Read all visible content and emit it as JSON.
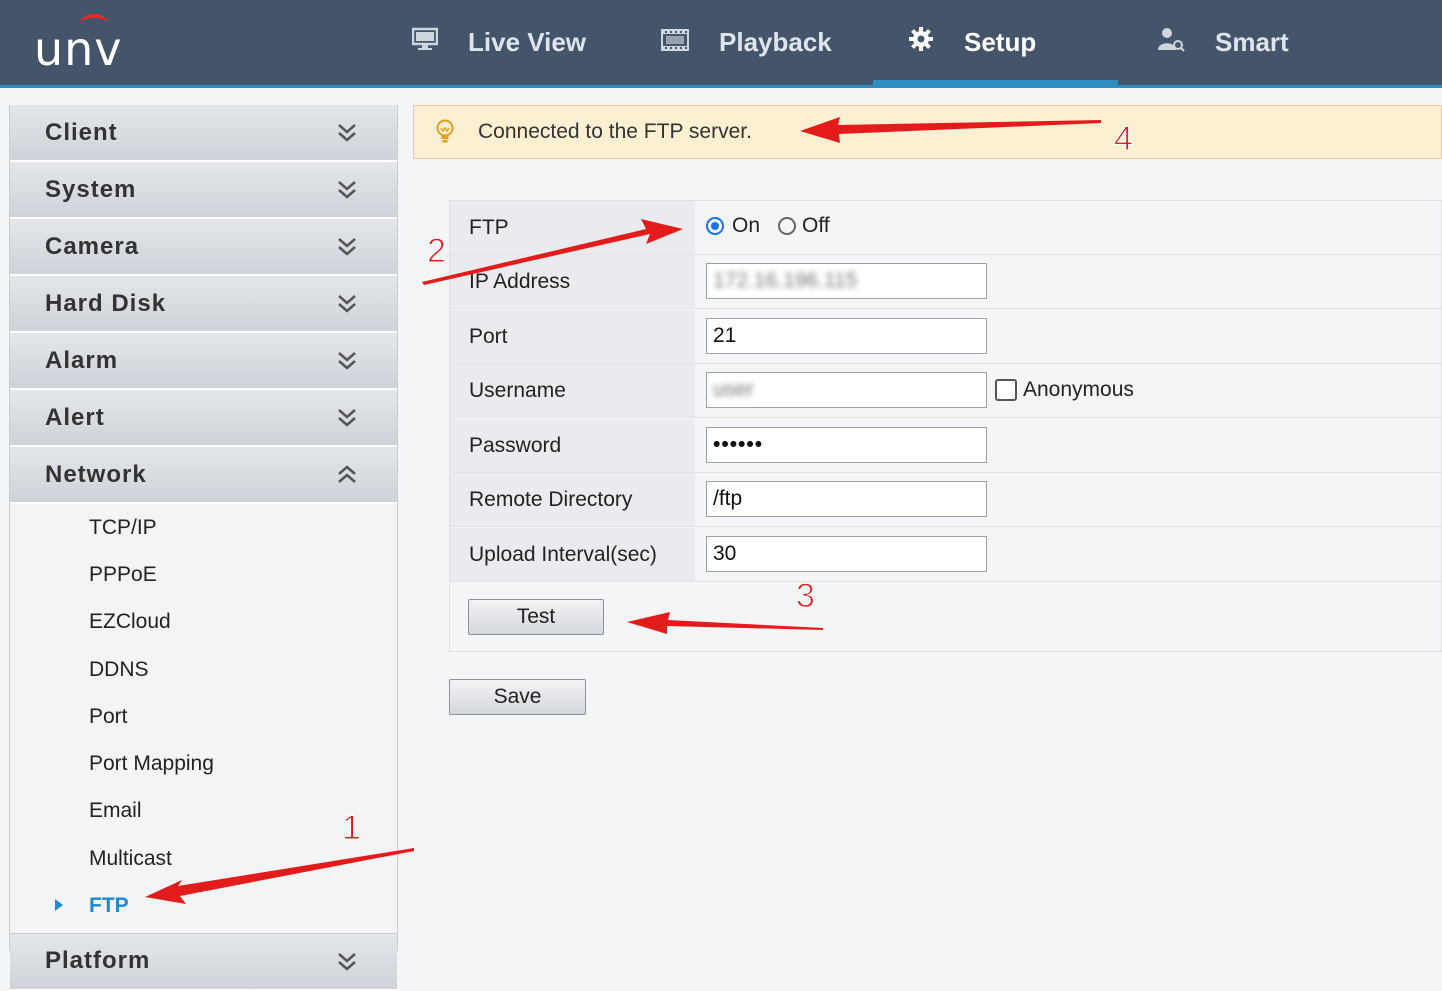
{
  "header": {
    "logo": "unv",
    "nav": [
      {
        "label": "Live View",
        "icon": "monitor-icon"
      },
      {
        "label": "Playback",
        "icon": "film-icon"
      },
      {
        "label": "Setup",
        "icon": "gear-icon",
        "active": true
      },
      {
        "label": "Smart",
        "icon": "user-search-icon"
      }
    ]
  },
  "sidebar": {
    "sections": [
      {
        "label": "Client",
        "expanded": false
      },
      {
        "label": "System",
        "expanded": false
      },
      {
        "label": "Camera",
        "expanded": false
      },
      {
        "label": "Hard Disk",
        "expanded": false
      },
      {
        "label": "Alarm",
        "expanded": false
      },
      {
        "label": "Alert",
        "expanded": false
      },
      {
        "label": "Network",
        "expanded": true
      },
      {
        "label": "Platform",
        "expanded": false
      }
    ],
    "network_items": [
      "TCP/IP",
      "PPPoE",
      "EZCloud",
      "DDNS",
      "Port",
      "Port Mapping",
      "Email",
      "Multicast",
      "FTP"
    ],
    "active_item": "FTP"
  },
  "alert": {
    "icon": "lightbulb-icon",
    "message": "Connected to the FTP server."
  },
  "form": {
    "ftp_label": "FTP",
    "on_label": "On",
    "off_label": "Off",
    "ftp_selected": "On",
    "ip_label": "IP Address",
    "ip_value": "172.16.196.115",
    "port_label": "Port",
    "port_value": "21",
    "username_label": "Username",
    "username_value": "user",
    "anonymous_label": "Anonymous",
    "anonymous_checked": false,
    "password_label": "Password",
    "password_value": "••••••",
    "remote_dir_label": "Remote Directory",
    "remote_dir_value": "/ftp",
    "interval_label": "Upload Interval(sec)",
    "interval_value": "30",
    "test_label": "Test",
    "save_label": "Save"
  },
  "annotations": [
    "1",
    "2",
    "3",
    "4"
  ],
  "colors": {
    "header_bg": "#44546a",
    "accent": "#2f8fc0",
    "active_link": "#1f8ad0",
    "alert_bg": "#fdefd2",
    "arrow": "#e31b1b"
  }
}
